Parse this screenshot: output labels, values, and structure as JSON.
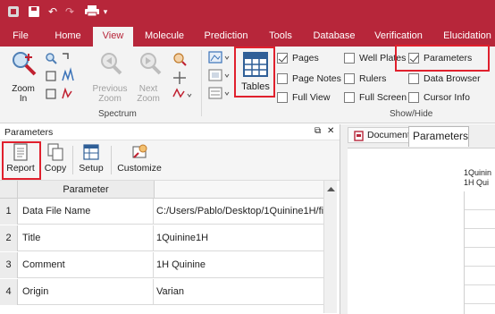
{
  "quick_access": {
    "undo_glyph": "↶",
    "redo_glyph": "↷",
    "more_glyph": "▾"
  },
  "tabs": [
    {
      "label": "File"
    },
    {
      "label": "Home"
    },
    {
      "label": "View",
      "active": true
    },
    {
      "label": "Molecule"
    },
    {
      "label": "Prediction"
    },
    {
      "label": "Tools"
    },
    {
      "label": "Database"
    },
    {
      "label": "Verification"
    },
    {
      "label": "Elucidation"
    }
  ],
  "ribbon": {
    "spectrum_group": {
      "label": "Spectrum",
      "zoom_in": "Zoom\nIn",
      "previous_zoom": "Previous\nZoom",
      "next_zoom": "Next\nZoom"
    },
    "tables_button": "Tables",
    "showhide_group": {
      "label": "Show/Hide",
      "checkboxes": [
        {
          "label": "Pages",
          "checked": true
        },
        {
          "label": "Page Notes",
          "checked": false
        },
        {
          "label": "Full View",
          "checked": false
        },
        {
          "label": "Well Plates",
          "checked": false
        },
        {
          "label": "Rulers",
          "checked": false
        },
        {
          "label": "Full Screen",
          "checked": false
        },
        {
          "label": "Parameters",
          "checked": true
        },
        {
          "label": "Data Browser",
          "checked": false
        },
        {
          "label": "Cursor Info",
          "checked": false
        }
      ]
    }
  },
  "parameters_pane": {
    "title": "Parameters",
    "pin_glyph": "⧉",
    "close_glyph": "✕",
    "toolbar": {
      "report": "Report",
      "copy": "Copy",
      "setup": "Setup",
      "customize": "Customize"
    },
    "grid": {
      "column_header": "Parameter",
      "rows": [
        {
          "num": "1",
          "parameter": "Data File Name",
          "value": "C:/Users/Pablo/Desktop/1Quinine1H/fi"
        },
        {
          "num": "2",
          "parameter": "Title",
          "value": "1Quinine1H"
        },
        {
          "num": "3",
          "parameter": "Comment",
          "value": "1H Quinine"
        },
        {
          "num": "4",
          "parameter": "Origin",
          "value": "Varian"
        }
      ]
    }
  },
  "document_panel": {
    "tab_document": "Document",
    "tab_parameters": "Parameters",
    "preview_line1": "1Quinin",
    "preview_line2": "1H Qui"
  },
  "colors": {
    "accent": "#b7263a",
    "highlight": "#e0202d"
  }
}
